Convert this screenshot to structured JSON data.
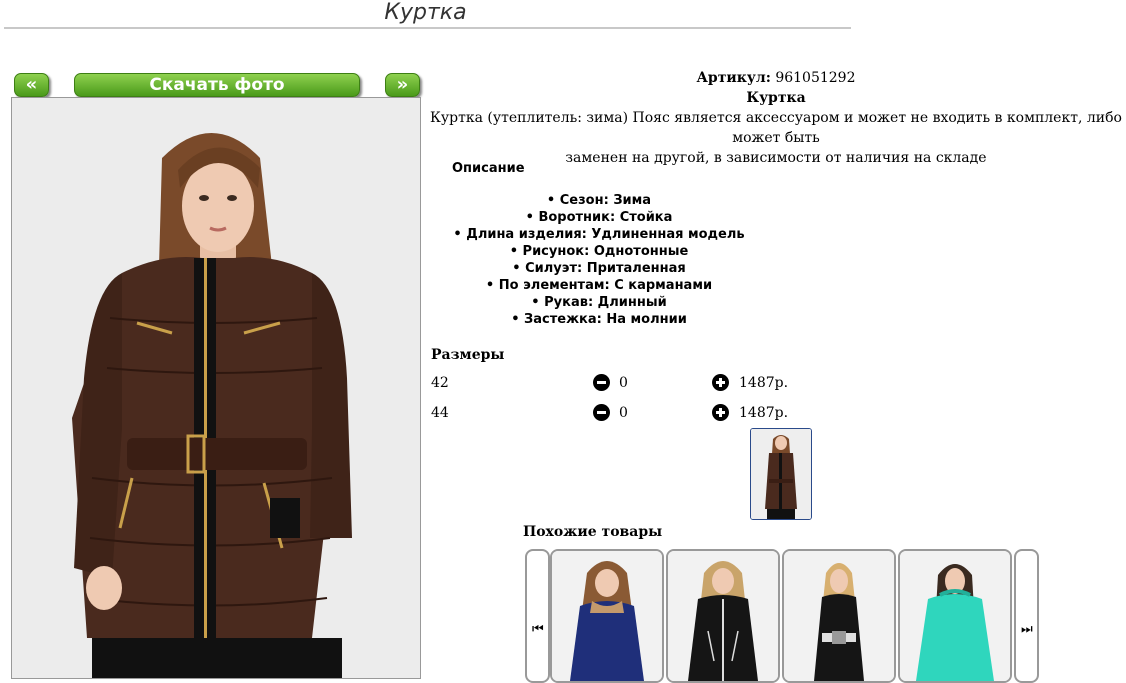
{
  "page": {
    "title": "Куртка"
  },
  "gallery": {
    "prev_label": "«",
    "download_label": "Скачать фото",
    "next_label": "»"
  },
  "product": {
    "article_label": "Артикул:",
    "article_value": "961051292",
    "name": "Куртка",
    "note_line1": "Куртка (утеплитель: зима) Пояс является аксессуаром и может не входить в комплект, либо может быть",
    "note_line2": "заменен на другой, в зависимости от наличия на складе",
    "description_title": "Описание",
    "features": [
      "Сезон: Зима",
      "Воротник: Стойка",
      "Длина изделия: Удлиненная модель",
      "Рисунок: Однотонные",
      "Силуэт: Приталенная",
      "По элементам: С карманами",
      "Рукав: Длинный",
      "Застежка: На молнии"
    ]
  },
  "sizes": {
    "title": "Размеры",
    "rows": [
      {
        "size": "42",
        "qty": "0",
        "price": "1487р."
      },
      {
        "size": "44",
        "qty": "0",
        "price": "1487р."
      }
    ]
  },
  "similar": {
    "title": "Похожие товары"
  },
  "colors": {
    "accent_green": "#5aa82a",
    "jacket_brown": "#4a2a1e",
    "navy_jacket": "#1f2f7a",
    "black_jacket": "#151515",
    "mint_jacket": "#2fd6bd"
  }
}
